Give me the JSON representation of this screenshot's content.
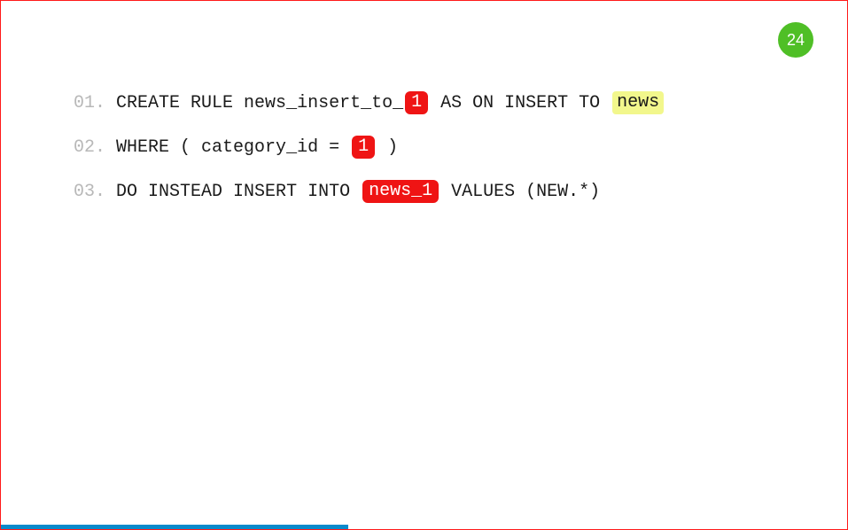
{
  "page_number": "24",
  "progress_pct": 41,
  "lines": [
    {
      "no": "01",
      "segs": [
        {
          "t": "text",
          "v": "CREATE RULE news_insert_to_"
        },
        {
          "t": "red",
          "v": "1"
        },
        {
          "t": "text",
          "v": " AS ON INSERT TO "
        },
        {
          "t": "yel",
          "v": "news"
        }
      ]
    },
    {
      "no": "02",
      "segs": [
        {
          "t": "text",
          "v": "WHERE ( category_id = "
        },
        {
          "t": "red",
          "v": "1"
        },
        {
          "t": "text",
          "v": " )"
        }
      ]
    },
    {
      "no": "03",
      "segs": [
        {
          "t": "text",
          "v": "DO INSTEAD INSERT INTO "
        },
        {
          "t": "red",
          "v": "news_1"
        },
        {
          "t": "text",
          "v": " VALUES (NEW.*)"
        }
      ]
    }
  ]
}
